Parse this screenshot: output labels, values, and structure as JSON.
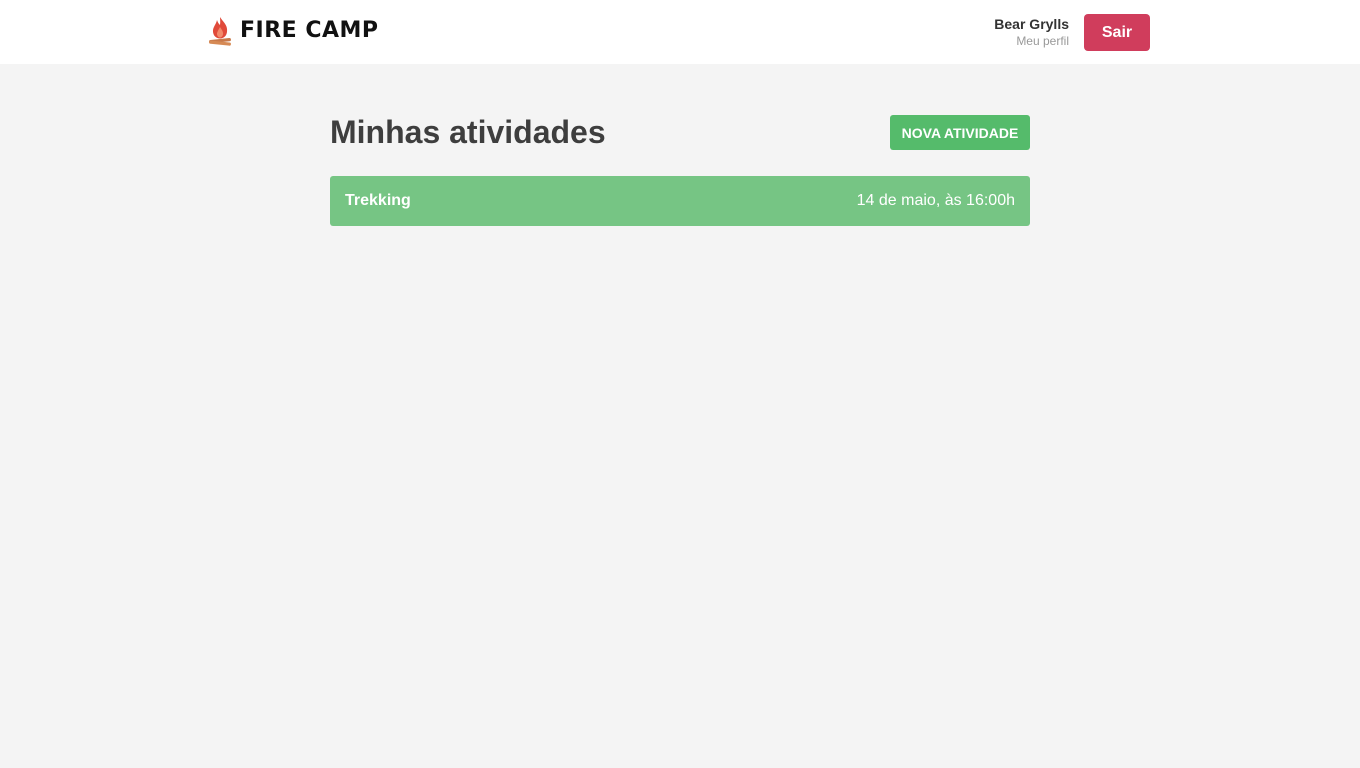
{
  "header": {
    "logo_text": "FIRE CAMP",
    "logo_icon": "campfire-icon",
    "user": {
      "name": "Bear Grylls",
      "profile_link": "Meu perfil"
    },
    "logout_label": "Sair"
  },
  "main": {
    "title": "Minhas atividades",
    "new_activity_label": "NOVA ATIVIDADE",
    "activities": [
      {
        "name": "Trekking",
        "date": "14 de maio, às 16:00h"
      }
    ]
  },
  "colors": {
    "background": "#f4f4f4",
    "header_bg": "#ffffff",
    "logout": "#d03d5c",
    "accent_green": "#55bb6b",
    "activity_green": "#76c584"
  }
}
